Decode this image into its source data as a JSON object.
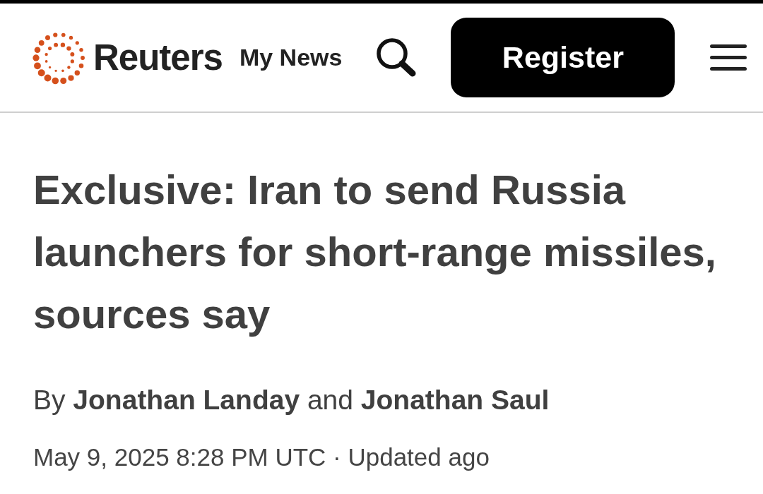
{
  "header": {
    "brand": "Reuters",
    "link": "My News",
    "register_button": "Register"
  },
  "article": {
    "headline": "Exclusive: Iran to send Russia launchers for short-range missiles, sources say",
    "byline": "By **Jonathan Landay** and **Jonathan Saul**",
    "dateline": "May 9, 2025 8:28 PM UTC · Updated ago"
  }
}
